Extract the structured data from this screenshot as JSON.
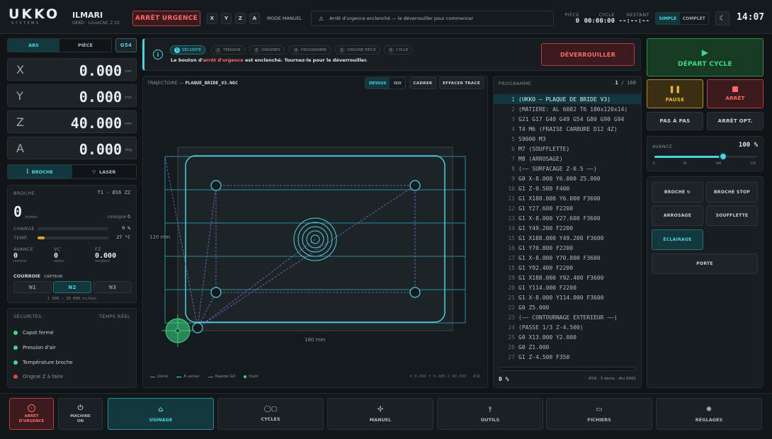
{
  "header": {
    "logo": "UKKO",
    "logo_sub": "SYSTEMS",
    "machine_name": "ILMARI",
    "software": "UKKO · LinuxCNC 2.10",
    "estop_label": "ARRÊT URGENCE",
    "axes": [
      "X",
      "Y",
      "Z",
      "A"
    ],
    "mode": "MODE MANUEL",
    "alert": "Arrêt d'urgence enclenché — le déverrouiller pour commencer",
    "piece_label": "PIÈCE",
    "piece_value": "0",
    "cycle_label": "CYCLE",
    "cycle_value": "00:00:00",
    "restant_label": "RESTANT",
    "restant_value": "--:--:--",
    "view_simple": "SIMPLE",
    "view_complet": "COMPLET",
    "time": "14:07"
  },
  "coords": {
    "tab_abs": "ABS",
    "tab_piece": "PIÈCE",
    "wcs": "G54",
    "axes": [
      {
        "name": "X",
        "value": "0.000",
        "unit": "mm"
      },
      {
        "name": "Y",
        "value": "0.000",
        "unit": "mm"
      },
      {
        "name": "Z",
        "value": "40.000",
        "unit": "mm"
      },
      {
        "name": "A",
        "value": "0.000",
        "unit": "deg"
      }
    ]
  },
  "tool_mode": {
    "broche": "BROCHE",
    "laser": "LASER"
  },
  "spindle": {
    "title": "BROCHE",
    "tool": "T1 · Ø16 Z2",
    "rpm": "0",
    "rpm_unit": "tr/min",
    "setpoint_label": "consigne",
    "setpoint": "0",
    "load_label": "CHARGE",
    "load_value": "0 %",
    "temp_label": "TEMP.",
    "temp_value": "27 °C",
    "temp_fraction": 0.1,
    "avance_label": "AVANCE",
    "avance_value": "0",
    "avance_unit": "mm/min",
    "vc_label": "VC",
    "vc_value": "0",
    "vc_unit": "m/min",
    "fz_label": "FZ",
    "fz_value": "0.000",
    "fz_unit": "mm/dent",
    "belt_label": "COURROIE",
    "belt_sensor": "CAPTEUR",
    "belts": [
      "N1",
      "N2",
      "N3"
    ],
    "belt_range": "1 500 – 10 000 tr/min"
  },
  "safety": {
    "title": "SÉCURITÉS",
    "realtime": "TEMPS RÉEL",
    "items": [
      {
        "label": "Capot fermé",
        "color": "#3ddc84"
      },
      {
        "label": "Pression d'air",
        "color": "#3ddc84"
      },
      {
        "label": "Température broche",
        "color": "#3ddc84"
      },
      {
        "label": "Origine Z à faire",
        "color": "#e04b4b"
      }
    ]
  },
  "steps": {
    "items": [
      "SÉCURITÉ",
      "TENSION",
      "ORIGINES",
      "PROGRAMME",
      "ORIGINE PIÈCE",
      "CYCLE"
    ],
    "numbers": [
      "1",
      "2",
      "3",
      "4",
      "5",
      "6"
    ],
    "message_pre": "Le bouton d'",
    "message_em": "arrêt d'urgence",
    "message_post": " est enclenché. Tournez-le pour le déverrouiller.",
    "unlock": "DÉVERROUILLER"
  },
  "trajectory": {
    "title": "TRAJECTOIRE —",
    "file": "PLAQUE_BRIDE_V3.NGC",
    "views": [
      "DESSUS",
      "ISO"
    ],
    "frame": "CADRER",
    "clear": "EFFACER TRACÉ",
    "dim_y": "120 mm",
    "dim_x": "180 mm",
    "legend": [
      {
        "label": "Usiné",
        "color": "#7f8b92"
      },
      {
        "label": "À usiner",
        "color": "#4fd1e0"
      },
      {
        "label": "Rapide G0",
        "color": "#7c6fd0"
      },
      {
        "label": "Outil",
        "color": "#3ddc84"
      }
    ],
    "coords": "X 0.000  Y 0.000  Z 40.000 · Ø16"
  },
  "program": {
    "title": "PROGRAMME",
    "line": "1",
    "total": "/ 160",
    "lines": [
      {
        "n": "1",
        "t": "(UKKO — PLAQUE DE BRIDE V3)"
      },
      {
        "n": "2",
        "t": "(MATIERE: AL 6082 T6 180x120x14)"
      },
      {
        "n": "3",
        "t": "G21 G17 G40 G49 G54 G80 G90 G94"
      },
      {
        "n": "4",
        "t": "T4 M6 (FRAISE CARBURE D12 4Z)"
      },
      {
        "n": "5",
        "t": "S9000 M3"
      },
      {
        "n": "6",
        "t": "M7 (SOUFFLETTE)"
      },
      {
        "n": "7",
        "t": "M8 (ARROSAGE)"
      },
      {
        "n": "8",
        "t": "(—— SURFACAGE Z-0.5 ——)"
      },
      {
        "n": "9",
        "t": "G0 X-8.000 Y6.000 Z5.000"
      },
      {
        "n": "10",
        "t": "G1 Z-0.500 F400"
      },
      {
        "n": "11",
        "t": "G1 X188.000 Y6.000 F3600"
      },
      {
        "n": "12",
        "t": "G1 Y27.600 F2200"
      },
      {
        "n": "13",
        "t": "G1 X-8.000 Y27.600 F3600"
      },
      {
        "n": "14",
        "t": "G1 Y49.200 F2200"
      },
      {
        "n": "15",
        "t": "G1 X188.000 Y49.200 F3600"
      },
      {
        "n": "16",
        "t": "G1 Y70.800 F2200"
      },
      {
        "n": "17",
        "t": "G1 X-8.000 Y70.800 F3600"
      },
      {
        "n": "18",
        "t": "G1 Y92.400 F2200"
      },
      {
        "n": "19",
        "t": "G1 X188.000 Y92.400 F3600"
      },
      {
        "n": "20",
        "t": "G1 Y114.000 F2200"
      },
      {
        "n": "21",
        "t": "G1 X-8.000 Y114.000 F3600"
      },
      {
        "n": "22",
        "t": "G0 Z5.000"
      },
      {
        "n": "23",
        "t": "(—— CONTOURNAGE EXTERIEUR ——)"
      },
      {
        "n": "24",
        "t": "(PASSE 1/3 Z-4.500)"
      },
      {
        "n": "25",
        "t": "G0 X13.000 Y2.000"
      },
      {
        "n": "26",
        "t": "G0 Z1.000"
      },
      {
        "n": "27",
        "t": "G1 Z-4.500 F350"
      }
    ],
    "progress": "0 %",
    "progress_fraction": 0,
    "tool_info": "Ø16 · 3 dents · Alu 6082"
  },
  "controls": {
    "start": "DÉPART CYCLE",
    "pause": "PAUSE",
    "stop": "ARRÊT",
    "step": "PAS À PAS",
    "opt_stop": "ARRÊT OPT.",
    "feed_label": "AVANCE",
    "feed_value": "100 %",
    "feed_fraction": 0.667,
    "feed_ticks": [
      "0",
      "50",
      "100",
      "150"
    ],
    "aux": [
      "BROCHE ↻",
      "BROCHE STOP",
      "ARROSAGE",
      "SOUFFLETTE",
      "ÉCLAIRAGE",
      "PORTE"
    ]
  },
  "nav": {
    "estop": "ARRÊT\nD'URGENCE",
    "machine": "MACHINE\nON",
    "items": [
      "USINAGE",
      "CYCLES",
      "MANUEL",
      "OUTILS",
      "FICHIERS",
      "RÉGLAGES"
    ]
  }
}
